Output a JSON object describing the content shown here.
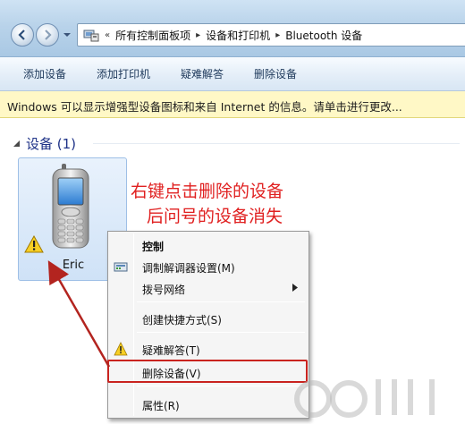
{
  "address": {
    "crumbs": [
      "所有控制面板项",
      "设备和打印机",
      "Bluetooth 设备"
    ],
    "lead": "«"
  },
  "toolbar": {
    "add_device": "添加设备",
    "add_printer": "添加打印机",
    "troubleshoot": "疑难解答",
    "remove_device": "删除设备"
  },
  "infobar": {
    "text": "Windows 可以显示增强型设备图标和来自 Internet 的信息。请单击进行更改..."
  },
  "group": {
    "title": "设备 (1)"
  },
  "device": {
    "name": "Eric"
  },
  "annotation": {
    "line1": "右键点击删除的设备",
    "line2": "后问号的设备消失"
  },
  "context_menu": {
    "items": [
      {
        "label": "控制"
      },
      {
        "label": "调制解调器设置(M)"
      },
      {
        "label": "拨号网络"
      },
      {
        "label": "创建快捷方式(S)"
      },
      {
        "label": "疑难解答(T)"
      },
      {
        "label": "删除设备(V)"
      },
      {
        "label": "属性(R)"
      }
    ]
  },
  "colors": {
    "annotation": "#e02020",
    "highlight_box": "#c9231f",
    "info_bar": "#fff8c6"
  }
}
